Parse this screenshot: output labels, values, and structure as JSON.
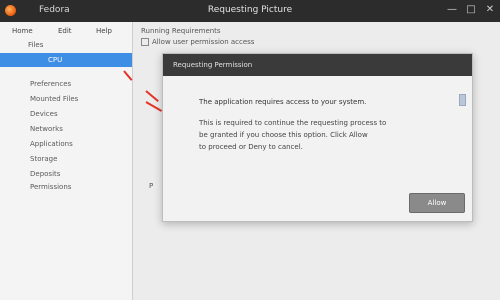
{
  "window": {
    "title": "Requesting Picture",
    "menu_label": "Fedora",
    "controls": {
      "minimize": "—",
      "maximize": "□",
      "close": "✕"
    }
  },
  "sidebar": {
    "header": {
      "left": "Home",
      "middle": "Edit",
      "right": "Help"
    },
    "sublabel": "Files",
    "selected_label": "CPU",
    "items": [
      "Preferences",
      "Mounted Files",
      "Devices",
      "Networks",
      "Applications",
      "Storage",
      "Deposits",
      "Permissions"
    ]
  },
  "main": {
    "label": "Running Requirements",
    "checkbox_label": "Allow user permission access",
    "fragment": "P"
  },
  "dialog": {
    "title": "Requesting Permission",
    "heading": "The application requires access to your system.",
    "body_lines": [
      "This is required to continue the requesting process to",
      "be granted if you choose this option. Click Allow",
      "to proceed or Deny to cancel."
    ],
    "button_label": "Allow"
  },
  "colors": {
    "titlebar": "#2c2c2c",
    "selection": "#3e8ee5",
    "annotation_red": "#e5332a",
    "dialog_button": "#8a8a8a"
  }
}
